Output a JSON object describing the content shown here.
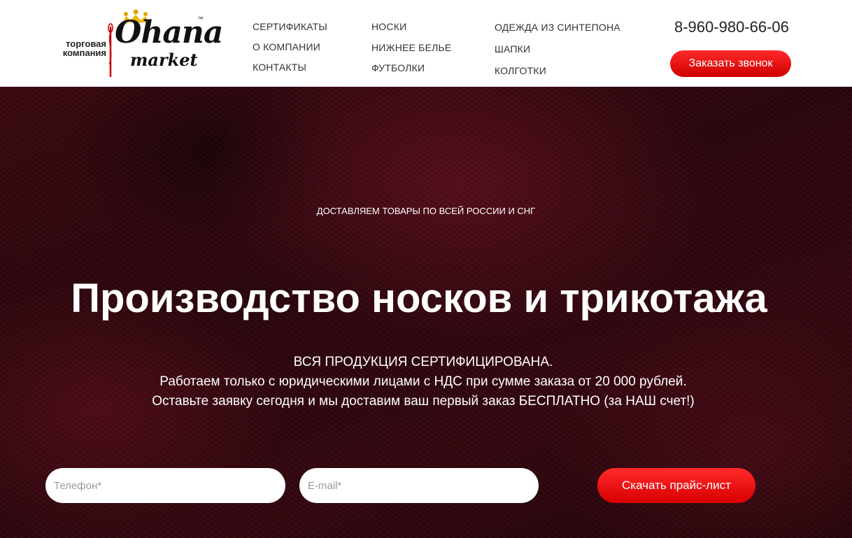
{
  "logo": {
    "company_line1": "торговая",
    "company_line2": "компания",
    "brand": "Ohana",
    "brand_sub": "market",
    "tm": "™"
  },
  "nav": {
    "col1": [
      "СЕРТИФИКАТЫ",
      "О КОМПАНИИ",
      "КОНТАКТЫ"
    ],
    "col2": [
      "НОСКИ",
      "НИЖНЕЕ БЕЛЬЕ",
      "ФУТБОЛКИ"
    ],
    "col3": [
      "ОДЕЖДА ИЗ СИНТЕПОНА",
      "ШАПКИ",
      "КОЛГОТКИ"
    ]
  },
  "contact": {
    "phone": "8-960-980-66-06",
    "call_button": "Заказать звонок"
  },
  "hero": {
    "subtitle": "ДОСТАВЛЯЕМ ТОВАРЫ ПО ВСЕЙ РОССИИ И СНГ",
    "title": "Производство носков и трикотажа",
    "lines": [
      "ВСЯ ПРОДУКЦИЯ СЕРТИФИЦИРОВАНА.",
      "Работаем только с юридическими лицами с НДС при сумме заказа от 20 000 рублей.",
      "Оставьте заявку сегодня и мы доставим ваш первый заказ БЕСПЛАТНО (за НАШ счет!)"
    ]
  },
  "form": {
    "phone_placeholder": "Телефон*",
    "email_placeholder": "E-mail*",
    "download_button": "Скачать прайс-лист"
  },
  "colors": {
    "accent": "#e60000",
    "hero_bg": "#2e060c",
    "nav_text": "#333333"
  }
}
